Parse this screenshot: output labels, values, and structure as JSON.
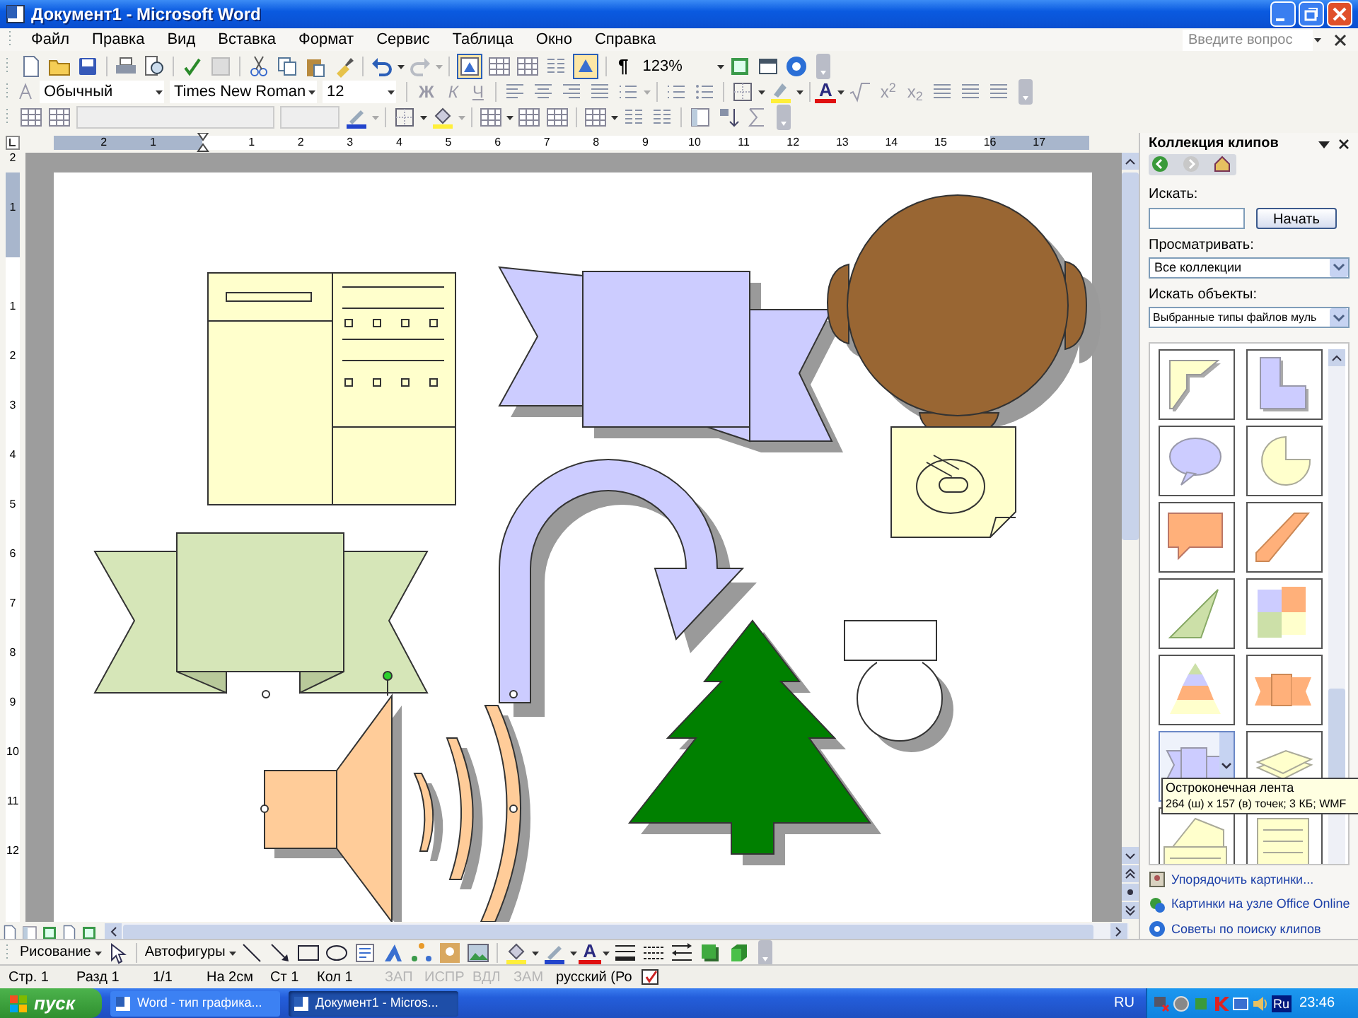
{
  "window": {
    "title": "Документ1 - Microsoft Word"
  },
  "menu": [
    "Файл",
    "Правка",
    "Вид",
    "Вставка",
    "Формат",
    "Сервис",
    "Таблица",
    "Окно",
    "Справка"
  ],
  "help_box": {
    "placeholder": "Введите вопрос"
  },
  "standard_toolbar": {
    "pilcrow": "¶",
    "zoom": "123%"
  },
  "formatting_toolbar": {
    "style": "Обычный",
    "font": "Times New Roman",
    "size": "12",
    "bold": "Ж",
    "italic": "К",
    "underline": "Ч",
    "font_color": "A",
    "superscript": "x$^{2}$",
    "subscript": "x$_{2}$"
  },
  "ruler": {
    "horizontal": [
      "2",
      "1",
      "1",
      "2",
      "3",
      "4",
      "5",
      "6",
      "7",
      "8",
      "9",
      "10",
      "11",
      "12",
      "13",
      "14",
      "15",
      "16",
      "17"
    ],
    "vertical": [
      "2",
      "1",
      "1",
      "2",
      "3",
      "4",
      "5",
      "6",
      "7",
      "8",
      "9",
      "10",
      "11",
      "12"
    ]
  },
  "task_pane": {
    "title": "Коллекция клипов",
    "search_label": "Искать:",
    "search_button": "Начать",
    "browse_label": "Просматривать:",
    "browse_value": "Все коллекции",
    "types_label": "Искать объекты:",
    "types_value": "Выбранные типы файлов муль"
  },
  "clips": [
    {
      "kind": "corner",
      "selected": false
    },
    {
      "kind": "lshape",
      "selected": false
    },
    {
      "kind": "speech_oval",
      "selected": false
    },
    {
      "kind": "pie",
      "selected": false
    },
    {
      "kind": "callout",
      "selected": false
    },
    {
      "kind": "band",
      "selected": false
    },
    {
      "kind": "triangle",
      "selected": false
    },
    {
      "kind": "puzzle",
      "selected": false
    },
    {
      "kind": "pyramid",
      "selected": false
    },
    {
      "kind": "ribbons",
      "selected": false
    },
    {
      "kind": "pointed_ribbon",
      "selected": true
    },
    {
      "kind": "papers",
      "selected": false
    },
    {
      "kind": "tank",
      "selected": false
    },
    {
      "kind": "note",
      "selected": false
    }
  ],
  "tooltip": {
    "title": "Остроконечная лента",
    "details": "264 (ш) x 157 (в) точек; 3 КБ; WMF"
  },
  "task_links": [
    "Упорядочить картинки...",
    "Картинки на узле Office Online",
    "Советы по поиску клипов"
  ],
  "drawing_toolbar": {
    "draw_menu": "Рисование",
    "autoshapes": "Автофигуры",
    "font_color": "A"
  },
  "status_bar": [
    {
      "text": "Стр. 1",
      "disabled": false
    },
    {
      "text": "Разд 1",
      "disabled": false
    },
    {
      "text": "1/1",
      "disabled": false
    },
    {
      "text": "На 2см",
      "disabled": false
    },
    {
      "text": "Ст 1",
      "disabled": false
    },
    {
      "text": "Кол 1",
      "disabled": false
    },
    {
      "text": "ЗАП",
      "disabled": true
    },
    {
      "text": "ИСПР",
      "disabled": true
    },
    {
      "text": "ВДЛ",
      "disabled": true
    },
    {
      "text": "ЗАМ",
      "disabled": true
    },
    {
      "text": "русский (Ро",
      "disabled": false
    }
  ],
  "taskbar": {
    "start": "пуск",
    "buttons": [
      {
        "label": "Word - тип графика...",
        "selected": false
      },
      {
        "label": "Документ1 - Micros...",
        "selected": true
      }
    ],
    "language": "RU",
    "tray_language": "Ru",
    "clock": "23:46"
  }
}
